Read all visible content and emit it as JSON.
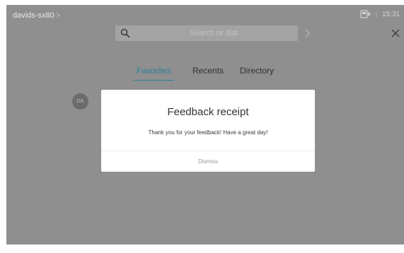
{
  "header": {
    "device_name": "davids-sx80",
    "device_chevron": ">",
    "separator": "|",
    "time": "15:31"
  },
  "search": {
    "placeholder": "Search or dial",
    "go_icon": "chevron-right-icon",
    "close_icon": "close-icon"
  },
  "tabs": [
    {
      "label": "Favorites",
      "active": true
    },
    {
      "label": "Recents",
      "active": false
    },
    {
      "label": "Directory",
      "active": false
    }
  ],
  "contact": {
    "initials": "DA"
  },
  "modal": {
    "title": "Feedback receipt",
    "message": "Thank you for your feedback! Have a great day!",
    "dismiss_label": "Dismiss"
  },
  "colors": {
    "overlay": "#8f8f8f",
    "active_tab": "#2a7f9b",
    "modal_bg": "#ffffff"
  }
}
